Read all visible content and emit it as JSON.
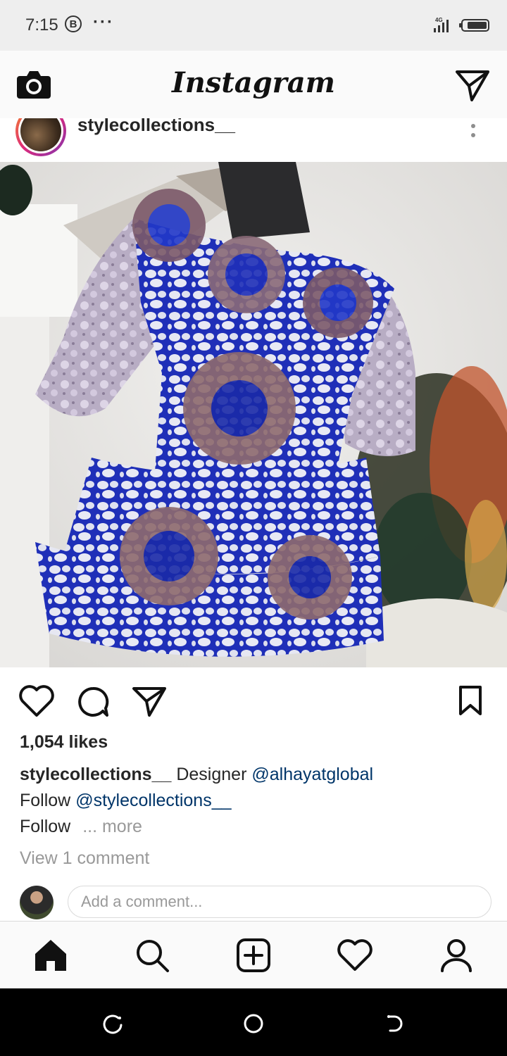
{
  "status_bar": {
    "time": "7:15",
    "badge": "B",
    "dots": "···",
    "network": "4G"
  },
  "header": {
    "title": "Instagram",
    "camera_icon": "camera-icon",
    "direct_icon": "paper-plane-icon"
  },
  "post": {
    "username": "stylecollections__",
    "image_description_icon": "photo",
    "likes": "1,054 likes",
    "caption": {
      "username": "stylecollections__",
      "line1_text": "Designer",
      "line1_mention": "@alhayatglobal",
      "line2_text": "Follow",
      "line2_mention": "@stylecollections__",
      "line3_text": "Follow",
      "more": "... more"
    },
    "view_comments": "View 1 comment",
    "comment_placeholder": "Add a comment..."
  },
  "colors": {
    "accent": "#003569",
    "muted": "#999999",
    "border": "#dbdbdb"
  }
}
